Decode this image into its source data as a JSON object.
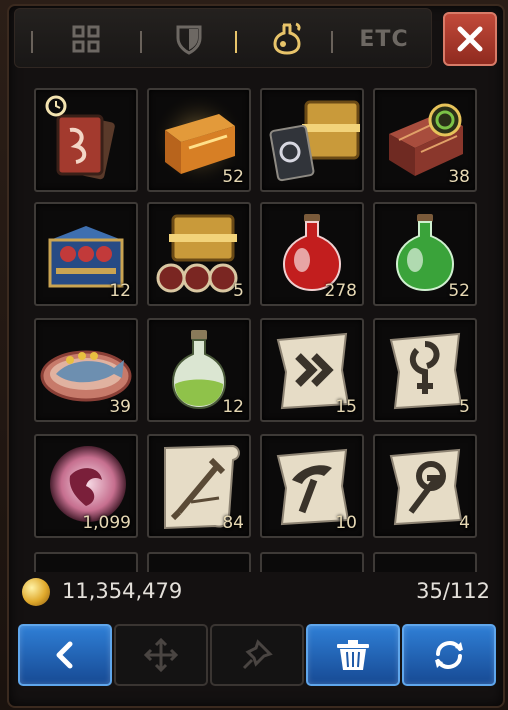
{
  "tabs": [
    {
      "name": "all-items",
      "icon": "grid-icon",
      "active": false
    },
    {
      "name": "equipment",
      "icon": "shield-icon",
      "active": false
    },
    {
      "name": "consumables",
      "icon": "potion-icon",
      "active": true
    },
    {
      "name": "etc",
      "label": "ETC",
      "active": false
    }
  ],
  "close": {
    "icon": "close-icon"
  },
  "items": [
    {
      "name": "timed-card-pack",
      "quantity": ""
    },
    {
      "name": "golden-chest",
      "quantity": "52"
    },
    {
      "name": "card-chest-bundle",
      "quantity": ""
    },
    {
      "name": "red-ornate-chest",
      "quantity": "38"
    },
    {
      "name": "blue-card-chest",
      "quantity": "12"
    },
    {
      "name": "gold-card-chest",
      "quantity": "5"
    },
    {
      "name": "red-potion",
      "quantity": "278"
    },
    {
      "name": "green-potion",
      "quantity": "52"
    },
    {
      "name": "fish-dish",
      "quantity": "39"
    },
    {
      "name": "green-elixir",
      "quantity": "12"
    },
    {
      "name": "scroll-arrows",
      "quantity": "15"
    },
    {
      "name": "scroll-rune",
      "quantity": "5"
    },
    {
      "name": "dragon-orb",
      "quantity": "1,099"
    },
    {
      "name": "scroll-sword",
      "quantity": "84"
    },
    {
      "name": "scroll-pickaxe",
      "quantity": "10"
    },
    {
      "name": "scroll-arrow-rune",
      "quantity": "4"
    }
  ],
  "gold": {
    "amount": "11,354,479",
    "icon": "gold-coin-icon"
  },
  "capacity": "35/112",
  "actions": [
    {
      "name": "back-button",
      "icon": "chevron-left-icon",
      "enabled": true
    },
    {
      "name": "move-button",
      "icon": "move-cross-icon",
      "enabled": false
    },
    {
      "name": "pin-button",
      "icon": "pin-icon",
      "enabled": false
    },
    {
      "name": "discard-button",
      "icon": "trash-icon",
      "enabled": true
    },
    {
      "name": "refresh-button",
      "icon": "refresh-icon",
      "enabled": true
    }
  ],
  "colors": {
    "accent_gold": "#e8c46a",
    "button_blue": "#2f7fd6",
    "close_red": "#b63a2c"
  }
}
